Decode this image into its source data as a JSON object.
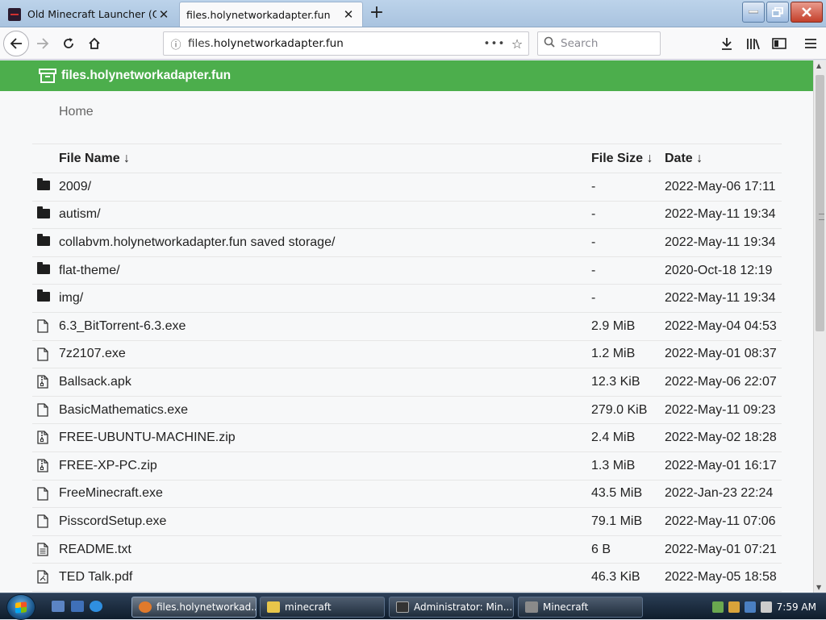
{
  "browser": {
    "tabs": [
      {
        "title": "Old Minecraft Launcher (Offici",
        "active": false
      },
      {
        "title": "files.holynetworkadapter.fun",
        "active": true
      }
    ],
    "new_tab": "+",
    "url_prefix": "files.",
    "url_domain": "holynetworkadapter.fun",
    "more_actions": "•••",
    "search_placeholder": "Search"
  },
  "site": {
    "title": "files.holynetworkadapter.fun",
    "breadcrumb": "Home",
    "columns": {
      "name": "File Name ↓",
      "size": "File Size ↓",
      "date": "Date ↓"
    },
    "rows": [
      {
        "type": "folder",
        "name": "2009/",
        "size": "-",
        "date": "2022-May-06 17:11"
      },
      {
        "type": "folder",
        "name": "autism/",
        "size": "-",
        "date": "2022-May-11 19:34"
      },
      {
        "type": "folder",
        "name": "collabvm.holynetworkadapter.fun saved storage/",
        "size": "-",
        "date": "2022-May-11 19:34"
      },
      {
        "type": "folder",
        "name": "flat-theme/",
        "size": "-",
        "date": "2020-Oct-18 12:19"
      },
      {
        "type": "folder",
        "name": "img/",
        "size": "-",
        "date": "2022-May-11 19:34"
      },
      {
        "type": "file",
        "name": "6.3_BitTorrent-6.3.exe",
        "size": "2.9 MiB",
        "date": "2022-May-04 04:53"
      },
      {
        "type": "file",
        "name": "7z2107.exe",
        "size": "1.2 MiB",
        "date": "2022-May-01 08:37"
      },
      {
        "type": "archive",
        "name": "Ballsack.apk",
        "size": "12.3 KiB",
        "date": "2022-May-06 22:07"
      },
      {
        "type": "file",
        "name": "BasicMathematics.exe",
        "size": "279.0 KiB",
        "date": "2022-May-11 09:23"
      },
      {
        "type": "archive",
        "name": "FREE-UBUNTU-MACHINE.zip",
        "size": "2.4 MiB",
        "date": "2022-May-02 18:28"
      },
      {
        "type": "archive",
        "name": "FREE-XP-PC.zip",
        "size": "1.3 MiB",
        "date": "2022-May-01 16:17"
      },
      {
        "type": "file",
        "name": "FreeMinecraft.exe",
        "size": "43.5 MiB",
        "date": "2022-Jan-23 22:24"
      },
      {
        "type": "file",
        "name": "PisscordSetup.exe",
        "size": "79.1 MiB",
        "date": "2022-May-11 07:06"
      },
      {
        "type": "text",
        "name": "README.txt",
        "size": "6 B",
        "date": "2022-May-01 07:21"
      },
      {
        "type": "pdf",
        "name": "TED Talk.pdf",
        "size": "46.3 KiB",
        "date": "2022-May-05 18:58"
      }
    ]
  },
  "taskbar": {
    "tasks": [
      {
        "label": "files.holynetworkad...",
        "active": true,
        "color": "#e07a2c"
      },
      {
        "label": "minecraft",
        "active": false,
        "color": "#e8c64a"
      },
      {
        "label": "Administrator: Min...",
        "active": false,
        "color": "#333333"
      },
      {
        "label": "Minecraft",
        "active": false,
        "color": "#8a8a8a"
      }
    ],
    "clock": "7:59 AM"
  },
  "colors": {
    "header_green": "#4cae4c"
  }
}
